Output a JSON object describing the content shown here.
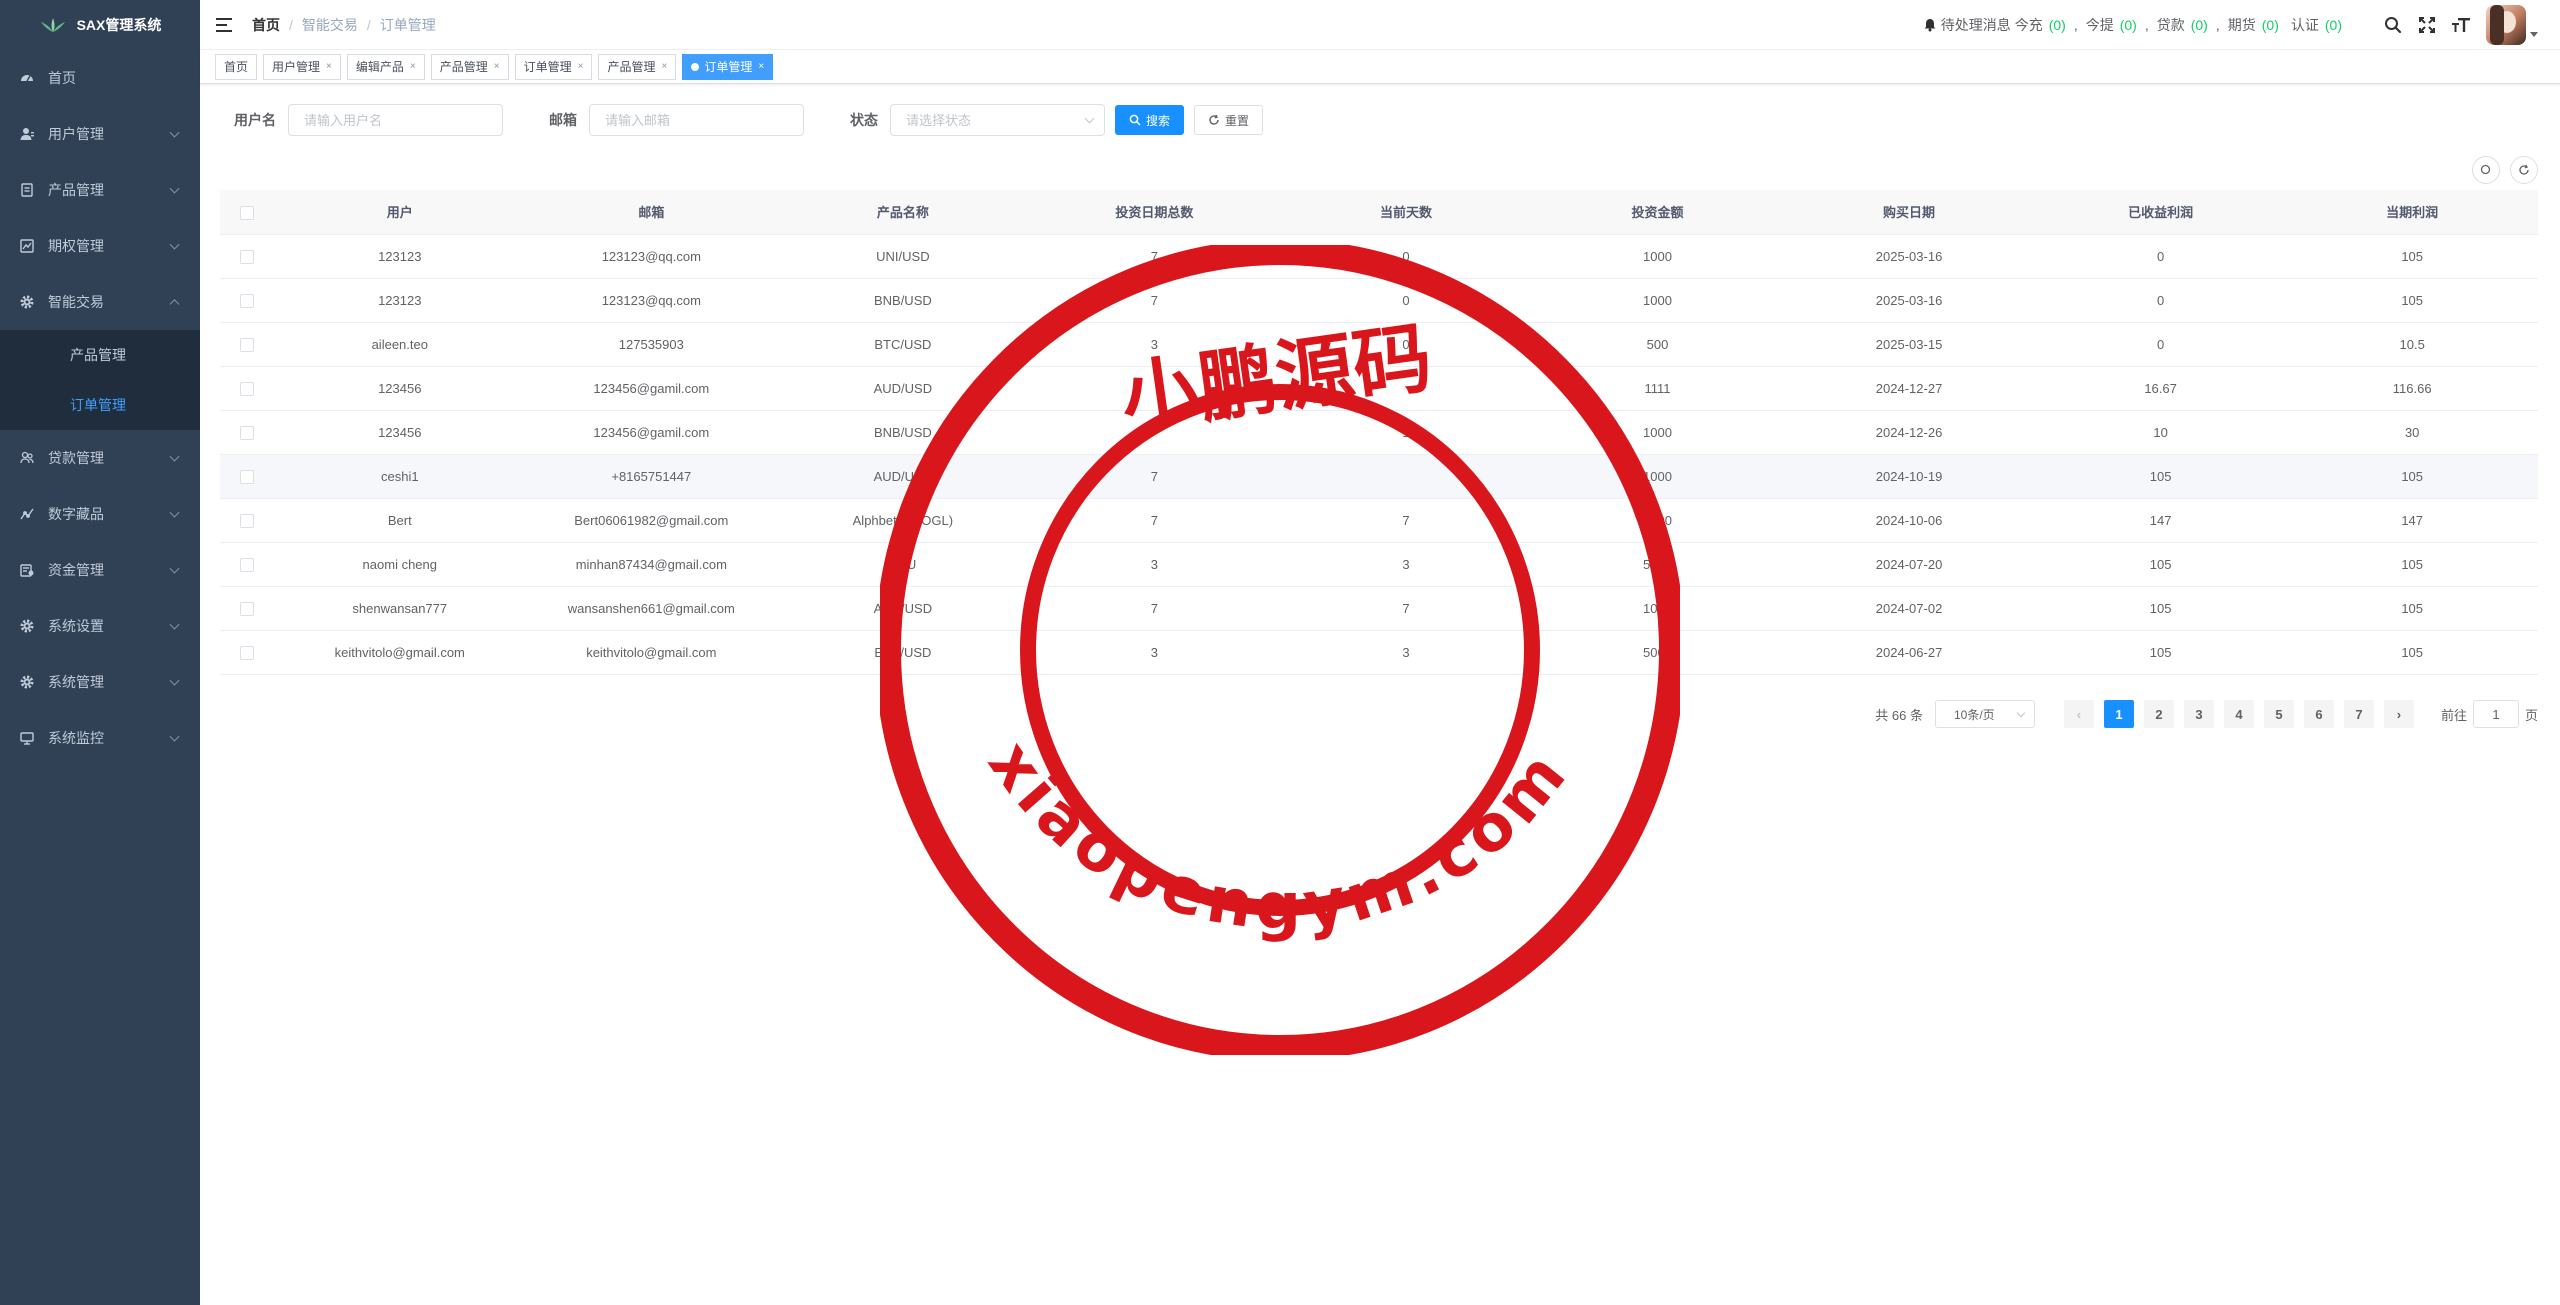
{
  "app": {
    "title": "SAX管理系统"
  },
  "sidebar": {
    "items": [
      {
        "label": "首页",
        "icon": "dashboard-icon",
        "has_children": false
      },
      {
        "label": "用户管理",
        "icon": "user-icon",
        "has_children": true
      },
      {
        "label": "产品管理",
        "icon": "documentation-icon",
        "has_children": true
      },
      {
        "label": "期权管理",
        "icon": "chart-icon",
        "has_children": true
      },
      {
        "label": "智能交易",
        "icon": "gear-icon",
        "has_children": true,
        "expanded": true,
        "children": [
          {
            "label": "产品管理",
            "active": false
          },
          {
            "label": "订单管理",
            "active": true
          }
        ]
      },
      {
        "label": "贷款管理",
        "icon": "peoples-icon",
        "has_children": true
      },
      {
        "label": "数字藏品",
        "icon": "trend-icon",
        "has_children": true
      },
      {
        "label": "资金管理",
        "icon": "money-icon",
        "has_children": true
      },
      {
        "label": "系统设置",
        "icon": "gear-icon",
        "has_children": true
      },
      {
        "label": "系统管理",
        "icon": "gear-icon",
        "has_children": true
      },
      {
        "label": "系统监控",
        "icon": "monitor-icon",
        "has_children": true
      }
    ]
  },
  "navbar": {
    "breadcrumb": [
      "首页",
      "智能交易",
      "订单管理"
    ],
    "notice": {
      "label": "待处理消息",
      "items": [
        {
          "label": "今充",
          "count": "(0)"
        },
        {
          "label": "今提",
          "count": "(0)"
        },
        {
          "label": "贷款",
          "count": "(0)"
        },
        {
          "label": "期货",
          "count": "(0)"
        },
        {
          "label": "认证",
          "count": "(0)"
        }
      ]
    }
  },
  "tags": [
    {
      "label": "首页",
      "closable": false,
      "active": false
    },
    {
      "label": "用户管理",
      "closable": true,
      "active": false
    },
    {
      "label": "编辑产品",
      "closable": true,
      "active": false
    },
    {
      "label": "产品管理",
      "closable": true,
      "active": false
    },
    {
      "label": "订单管理",
      "closable": true,
      "active": false
    },
    {
      "label": "产品管理",
      "closable": true,
      "active": false
    },
    {
      "label": "订单管理",
      "closable": true,
      "active": true
    }
  ],
  "search": {
    "username_label": "用户名",
    "username_placeholder": "请输入用户名",
    "email_label": "邮箱",
    "email_placeholder": "请输入邮箱",
    "status_label": "状态",
    "status_placeholder": "请选择状态",
    "search_button": "搜索",
    "reset_button": "重置"
  },
  "table": {
    "columns": [
      "用户",
      "邮箱",
      "产品名称",
      "投资日期总数",
      "当前天数",
      "投资金额",
      "购买日期",
      "已收益利润",
      "当期利润"
    ],
    "rows": [
      [
        "123123",
        "123123@qq.com",
        "UNI/USD",
        "7",
        "0",
        "1000",
        "2025-03-16",
        "0",
        "105"
      ],
      [
        "123123",
        "123123@qq.com",
        "BNB/USD",
        "7",
        "0",
        "1000",
        "2025-03-16",
        "0",
        "105"
      ],
      [
        "aileen.teo",
        "127535903",
        "BTC/USD",
        "3",
        "0",
        "500",
        "2025-03-15",
        "0",
        "10.5"
      ],
      [
        "123456",
        "123456@gamil.com",
        "AUD/USD",
        "",
        "",
        "1111",
        "2024-12-27",
        "16.67",
        "116.66"
      ],
      [
        "123456",
        "123456@gamil.com",
        "BNB/USD",
        "",
        "1",
        "1000",
        "2024-12-26",
        "10",
        "30"
      ],
      [
        "ceshi1",
        "+8165751447",
        "AUD/USD",
        "7",
        "",
        "1000",
        "2024-10-19",
        "105",
        "105"
      ],
      [
        "Bert",
        "Bert06061982@gmail.com",
        "Alphbet(GOOGL)",
        "7",
        "7",
        "1000",
        "2024-10-06",
        "147",
        "147"
      ],
      [
        "naomi cheng",
        "minhan87434@gmail.com",
        "XAU",
        "3",
        "3",
        "5000",
        "2024-07-20",
        "105",
        "105"
      ],
      [
        "shenwansan777",
        "wansanshen661@gmail.com",
        "AUD/USD",
        "7",
        "7",
        "1000",
        "2024-07-02",
        "105",
        "105"
      ],
      [
        "keithvitolo@gmail.com",
        "keithvitolo@gmail.com",
        "ETH/USD",
        "3",
        "3",
        "5000",
        "2024-06-27",
        "105",
        "105"
      ]
    ],
    "highlight_row": 5
  },
  "pagination": {
    "total_text": "共 66 条",
    "page_size": "10条/页",
    "pages": [
      "1",
      "2",
      "3",
      "4",
      "5",
      "6",
      "7"
    ],
    "current": "1",
    "goto_label": "前往",
    "goto_value": "1",
    "page_suffix": "页"
  },
  "watermark": {
    "text_top": "小鹏源码",
    "text_bottom": "xiaopengym.com",
    "color": "#d9161c"
  },
  "colors": {
    "sidebar_bg": "#304156",
    "submenu_bg": "#1f2d3d",
    "accent": "#1890ff",
    "notice_count": "#13ce66"
  }
}
